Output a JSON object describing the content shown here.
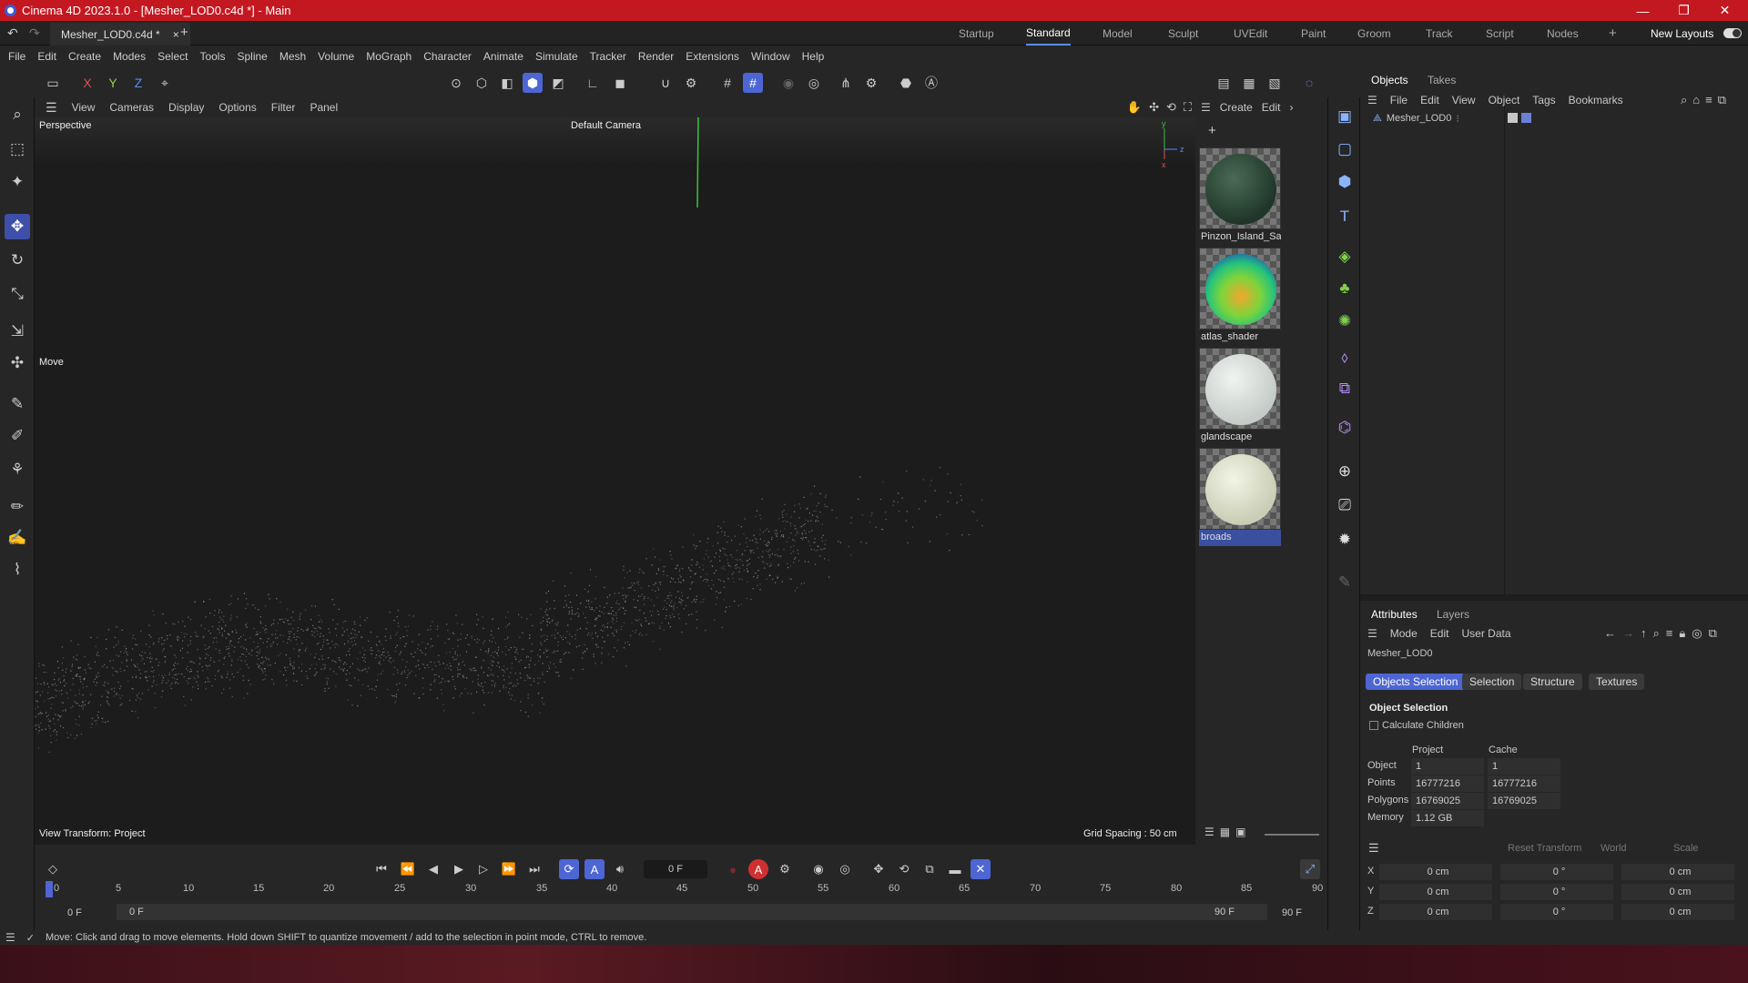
{
  "window": {
    "title": "Cinema 4D 2023.1.0 - [Mesher_LOD0.c4d *] - Main"
  },
  "doc_tab": {
    "name": "Mesher_LOD0.c4d *",
    "close": "×",
    "add": "+"
  },
  "layouts": [
    "Startup",
    "Standard",
    "Model",
    "Sculpt",
    "UVEdit",
    "Paint",
    "Groom",
    "Track",
    "Script",
    "Nodes"
  ],
  "layouts_active": "Standard",
  "new_layouts": "New Layouts",
  "menu": [
    "File",
    "Edit",
    "Create",
    "Modes",
    "Select",
    "Tools",
    "Spline",
    "Mesh",
    "Volume",
    "MoGraph",
    "Character",
    "Animate",
    "Simulate",
    "Tracker",
    "Render",
    "Extensions",
    "Window",
    "Help"
  ],
  "axis_lock": {
    "x": "X",
    "y": "Y",
    "z": "Z"
  },
  "viewport_menu": [
    "View",
    "Cameras",
    "Display",
    "Options",
    "Filter",
    "Panel"
  ],
  "viewport": {
    "projection": "Perspective",
    "camera": "Default Camera",
    "tool_hud": "Move",
    "view_transform": "View Transform: Project",
    "grid_spacing": "Grid Spacing : 50 cm"
  },
  "material_menu": {
    "create": "Create",
    "edit": "Edit"
  },
  "materials": [
    {
      "name": "Pinzon_Island_Sat",
      "color": "#2d4a3a"
    },
    {
      "name": "atlas_shader",
      "color": "#5bd05a"
    },
    {
      "name": "glandscape",
      "color": "#d8ddd9"
    },
    {
      "name": "broads",
      "color": "#dfe3cf"
    }
  ],
  "objects_panel": {
    "tabs": [
      "Objects",
      "Takes"
    ],
    "menu": [
      "File",
      "Edit",
      "View",
      "Object",
      "Tags",
      "Bookmarks"
    ],
    "items": [
      {
        "name": "Mesher_LOD0"
      }
    ]
  },
  "attributes_panel": {
    "tabs": [
      "Attributes",
      "Layers"
    ],
    "menu": [
      "Mode",
      "Edit",
      "User Data"
    ],
    "object_name": "Mesher_LOD0",
    "sub_tabs": [
      "Objects Selection",
      "Selection",
      "Structure",
      "Textures"
    ],
    "section": "Object Selection",
    "calc_children": "Calculate Children",
    "col_project": "Project",
    "col_cache": "Cache",
    "rows": [
      {
        "label": "Object",
        "project": "1",
        "cache": "1"
      },
      {
        "label": "Points",
        "project": "16777216",
        "cache": "16777216"
      },
      {
        "label": "Polygons",
        "project": "16769025",
        "cache": "16769025"
      },
      {
        "label": "Memory",
        "project": "1.12 GB",
        "cache": ""
      }
    ],
    "transform": {
      "reset": "Reset Transform",
      "space": "World",
      "mode": "Scale",
      "rows": [
        {
          "axis": "X",
          "pos": "0 cm",
          "rot": "0 °",
          "scale": "0 cm"
        },
        {
          "axis": "Y",
          "pos": "0 cm",
          "rot": "0 °",
          "scale": "0 cm"
        },
        {
          "axis": "Z",
          "pos": "0 cm",
          "rot": "0 °",
          "scale": "0 cm"
        }
      ]
    }
  },
  "timeline": {
    "current_frame": "0 F",
    "ruler": [
      "0",
      "5",
      "10",
      "15",
      "20",
      "25",
      "30",
      "35",
      "40",
      "45",
      "50",
      "55",
      "60",
      "65",
      "70",
      "75",
      "80",
      "85",
      "90"
    ],
    "start": "0 F",
    "range_start": "0 F",
    "range_end": "90 F",
    "end": "90 F"
  },
  "status": "Move: Click and drag to move elements. Hold down SHIFT to quantize movement / add to the selection in point mode, CTRL to remove."
}
